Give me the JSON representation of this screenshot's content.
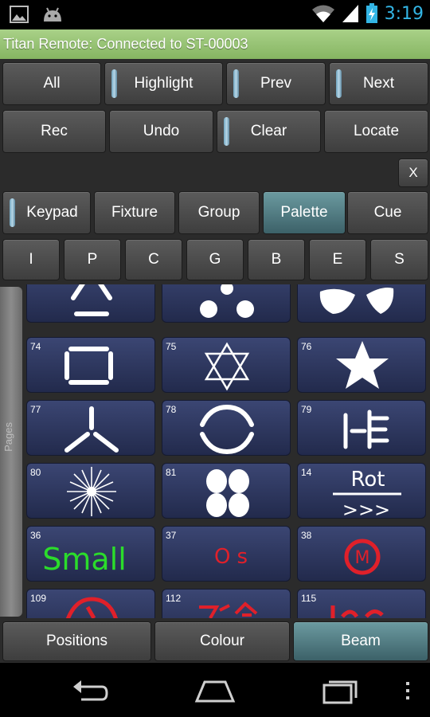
{
  "status_bar": {
    "time": "3:19"
  },
  "title": "Titan Remote: Connected to ST-00003",
  "row1": {
    "all": "All",
    "highlight": "Highlight",
    "prev": "Prev",
    "next": "Next"
  },
  "row2": {
    "rec": "Rec",
    "undo": "Undo",
    "clear": "Clear",
    "locate": "Locate"
  },
  "close_label": "X",
  "modes": {
    "keypad": "Keypad",
    "fixture": "Fixture",
    "group": "Group",
    "palette": "Palette",
    "cue": "Cue"
  },
  "filters": [
    "I",
    "P",
    "C",
    "G",
    "B",
    "E",
    "S"
  ],
  "palette_cells": [
    {
      "num": "",
      "icon": "triangle-bars-icon"
    },
    {
      "num": "",
      "icon": "three-dots-icon"
    },
    {
      "num": "",
      "icon": "petals-icon"
    },
    {
      "num": "74",
      "icon": "square-bars-icon"
    },
    {
      "num": "75",
      "icon": "star-of-david-icon"
    },
    {
      "num": "76",
      "icon": "star-icon"
    },
    {
      "num": "77",
      "icon": "tri-spoke-icon"
    },
    {
      "num": "78",
      "icon": "broken-circle-icon"
    },
    {
      "num": "79",
      "icon": "bars-pattern-icon"
    },
    {
      "num": "80",
      "icon": "starburst-icon"
    },
    {
      "num": "81",
      "icon": "four-dots-icon"
    },
    {
      "num": "14",
      "icon": "rot-icon",
      "text": "Rot",
      "subtext": ">>>"
    },
    {
      "num": "36",
      "icon": "small-text-icon",
      "text": "Small"
    },
    {
      "num": "37",
      "icon": "os-text-icon",
      "text": "Os"
    },
    {
      "num": "38",
      "icon": "m-circle-icon",
      "text": "M"
    },
    {
      "num": "109",
      "icon": "red-shape-icon"
    },
    {
      "num": "112",
      "icon": "red-glyph-icon"
    },
    {
      "num": "115",
      "icon": "red-scribble-icon"
    }
  ],
  "pages_label": "Pages",
  "bottom_tabs": {
    "positions": "Positions",
    "colour": "Colour",
    "beam": "Beam"
  },
  "colors": {
    "status_blue": "#33b5e5",
    "title_green": "#8fbf6b",
    "active_teal": "#4f7f86",
    "cell_navy": "#2d3760"
  }
}
